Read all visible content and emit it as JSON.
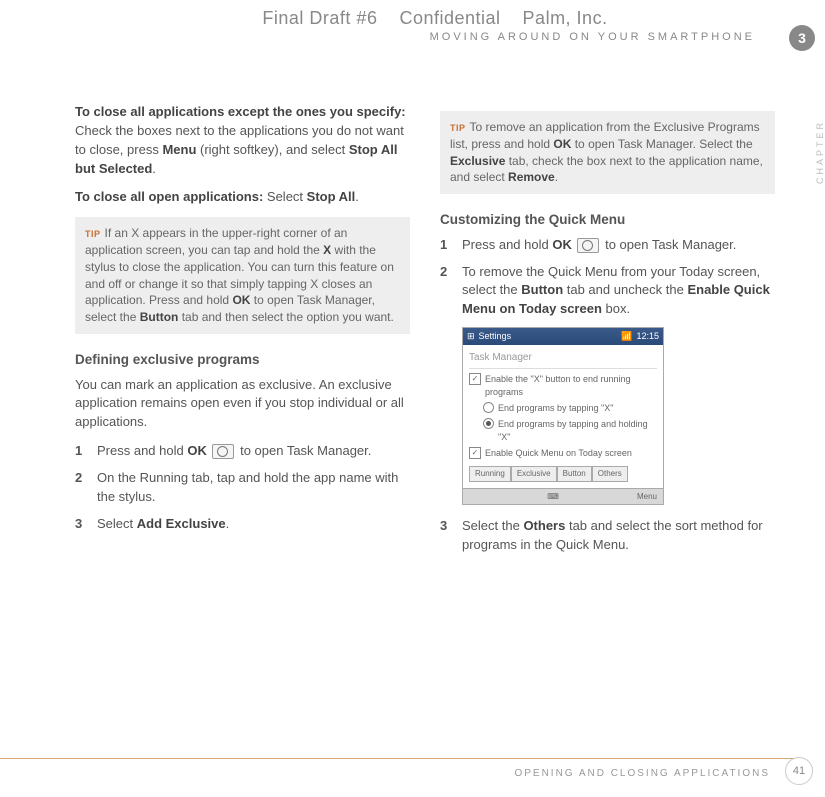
{
  "header": {
    "draft": "Final Draft #6",
    "confidential": "Confidential",
    "company": "Palm, Inc.",
    "running": "MOVING AROUND ON YOUR SMARTPHONE"
  },
  "chapter": {
    "num": "3",
    "label": "CHAPTER"
  },
  "left": {
    "p1_lead": "To close all applications except the ones you specify:",
    "p1_a": " Check the boxes next to the applications you do not want to close, press ",
    "p1_b1": "Menu",
    "p1_c": " (right softkey), and select ",
    "p1_b2": "Stop All but Selected",
    "p1_d": ".",
    "p2_lead": "To close all open applications:",
    "p2_a": " Select ",
    "p2_b": "Stop All",
    "p2_c": ".",
    "tip1_a": "If an X appears in the upper-right corner of an application screen, you can tap and hold the ",
    "tip1_b1": "X",
    "tip1_c": " with the stylus to close the application. You can turn this feature on and off or change it so that simply tapping X closes an application. Press and hold ",
    "tip1_b2": "OK",
    "tip1_d": " to open Task Manager, select the ",
    "tip1_b3": "Button",
    "tip1_e": " tab and then select the option you want.",
    "sub1": "Defining exclusive programs",
    "p3": "You can mark an application as exclusive. An exclusive application remains open even if you stop individual or all applications.",
    "s1_a": "Press and hold ",
    "s1_b": "OK",
    "s1_c": " to open Task Manager.",
    "s2": "On the Running tab, tap and hold the app name with the stylus.",
    "s3_a": "Select ",
    "s3_b": "Add Exclusive",
    "s3_c": "."
  },
  "right": {
    "tip2_a": "To remove an application from the Exclusive Programs list, press and hold ",
    "tip2_b1": "OK",
    "tip2_c": " to open Task Manager. Select the ",
    "tip2_b2": "Exclusive",
    "tip2_d": " tab, check the box next to the application name, and select ",
    "tip2_b3": "Remove",
    "tip2_e": ".",
    "sub2": "Customizing the Quick Menu",
    "r1_a": "Press and hold ",
    "r1_b": "OK",
    "r1_c": " to open Task Manager.",
    "r2_a": "To remove the Quick Menu from your Today screen, select the ",
    "r2_b1": "Button",
    "r2_c": " tab and uncheck the ",
    "r2_b2": "Enable Quick Menu on Today screen",
    "r2_d": " box.",
    "r3_a": "Select the ",
    "r3_b": "Others",
    "r3_c": " tab and select the sort method for programs in the Quick Menu."
  },
  "screenshot": {
    "title": "Settings",
    "time": "12:15",
    "sub": "Task Manager",
    "opt1": "Enable the \"X\" button to end running programs",
    "opt1a": "End programs by tapping \"X\"",
    "opt1b": "End programs by tapping and holding \"X\"",
    "opt2": "Enable Quick Menu on Today screen",
    "tabs": [
      "Running",
      "Exclusive",
      "Button",
      "Others"
    ],
    "menu": "Menu"
  },
  "tip_label": "TIP",
  "footer": {
    "text": "OPENING AND CLOSING APPLICATIONS",
    "page": "41"
  },
  "nums": {
    "n1": "1",
    "n2": "2",
    "n3": "3"
  }
}
